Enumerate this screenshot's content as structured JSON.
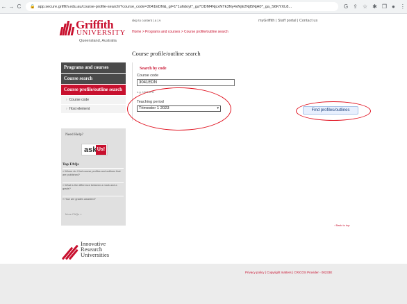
{
  "browser": {
    "url": "app.secure.griffith.edu.au/course-profile-search/?course_code=3041EDN&_gl=1*1u6doyt*_ga*ODM4NjcxNTk3Ny4xNjE2NjI5NjA0*_ga_S6KYXL8...",
    "nav_icons": [
      "←",
      "→",
      "C"
    ],
    "tool_icons": [
      "G",
      "⇪",
      "☆",
      "✱",
      "❐",
      "●",
      "⋮"
    ]
  },
  "logo": {
    "word1": "Griffith",
    "word2": "UNIVERSITY",
    "word3": "Queensland, Australia"
  },
  "header": {
    "skip": "skip to content | a | A",
    "links": "myGriffith | Staff portal | Contact us"
  },
  "breadcrumb": "Home > Programs and courses > Course profile/outline search",
  "page_title": "Course profile/outline search",
  "sidebar": {
    "items": [
      {
        "label": "Programs and courses"
      },
      {
        "label": "Course search"
      },
      {
        "label": "Course profile/outline search"
      }
    ],
    "subitems": [
      {
        "label": "Course code"
      },
      {
        "label": "Host element"
      }
    ]
  },
  "help": {
    "need_help": "Need Help?",
    "ask": "ask",
    "us": "Us!",
    "faq_header": "Top FAQs",
    "faqs": [
      "» Where do I find course profiles and outlines that are published?",
      "» What is the difference between a mark and a grade?",
      "» How are grades awarded?"
    ],
    "footer": "More FAQs »"
  },
  "search": {
    "header": "Search by code",
    "course_code_label": "Course code",
    "course_code_value": "3041EDN",
    "example": "e.g. 1001APB",
    "teaching_period_label": "Teaching period",
    "teaching_period_value": "Trimester 1 2023",
    "find_button": "Find profiles/outlines"
  },
  "back_to_top": "Back to top",
  "iru": {
    "line1": "Innovative",
    "line2": "Research",
    "line3": "Universities"
  },
  "footer": {
    "links": "Privacy policy | Copyright matters | CRICOS Provider - 00233E"
  },
  "colors": {
    "brand_red": "#c8102e",
    "annotation_red": "#e0101e",
    "nav_dark": "#4a4a4a"
  }
}
